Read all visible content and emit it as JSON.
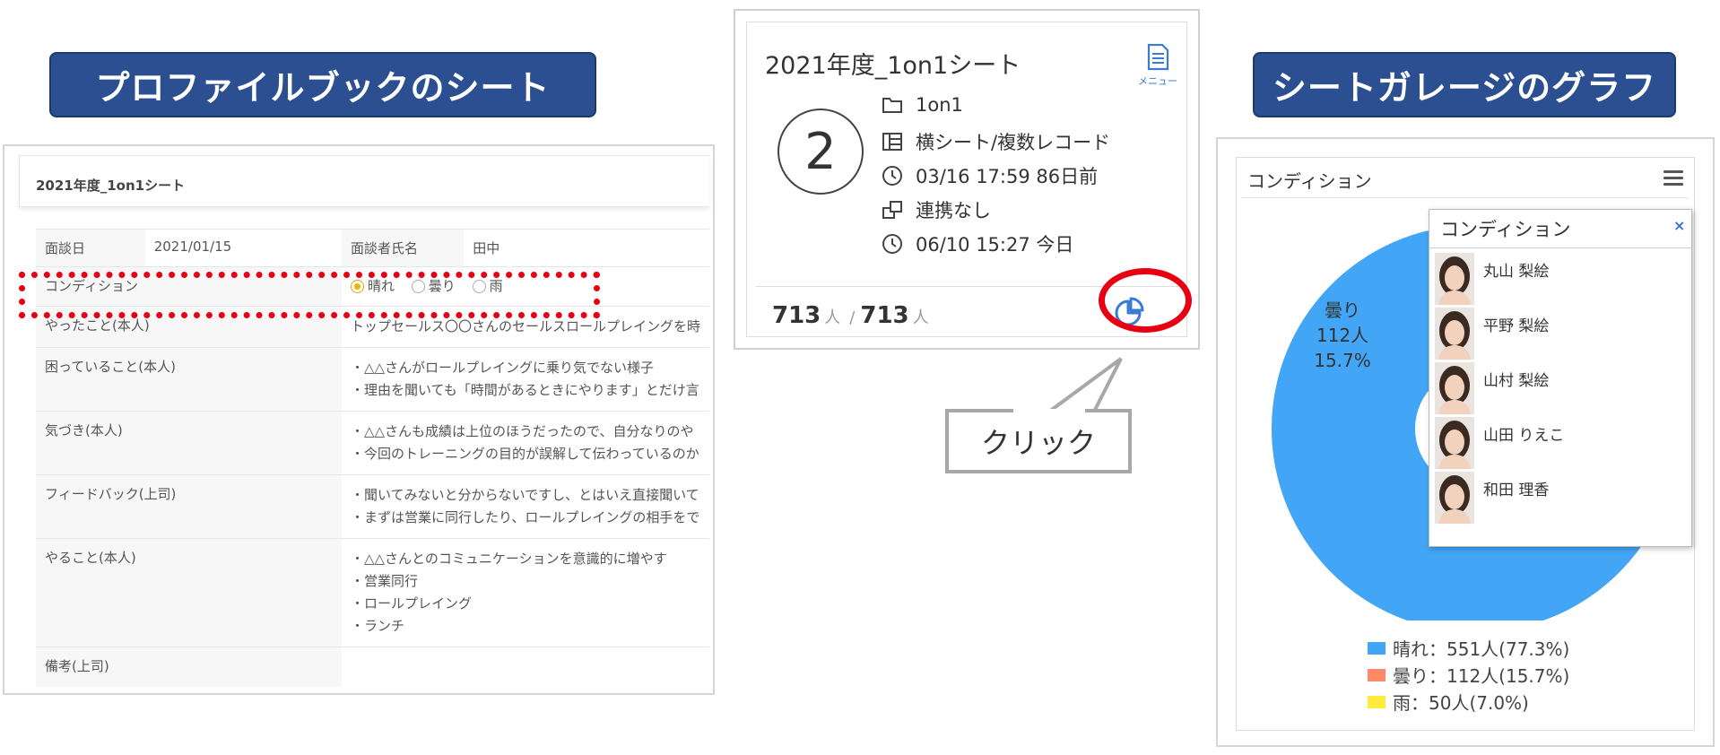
{
  "left_banner": {
    "label": "プロファイルブックのシート"
  },
  "right_banner": {
    "label": "シートガレージのグラフ"
  },
  "sheet": {
    "title": "2021年度_1on1シート",
    "rows": [
      {
        "label": "面談日",
        "value": "2021/01/15",
        "label2": "面談者氏名",
        "value2": "田中"
      },
      {
        "label": "コンディション",
        "options": [
          "晴れ",
          "曇り",
          "雨"
        ],
        "selected": "晴れ"
      },
      {
        "label": "やったこと(本人)",
        "lines": [
          "トップセールス〇〇さんのセールスロールプレイングを時"
        ]
      },
      {
        "label": "困っていること(本人)",
        "lines": [
          "・△△さんがロールプレイングに乗り気でない様子",
          "・理由を聞いても「時間があるときにやります」とだけ言"
        ]
      },
      {
        "label": "気づき(本人)",
        "lines": [
          "・△△さんも成績は上位のほうだったので、自分なりのや",
          "・今回のトレーニングの目的が誤解して伝わっているのか"
        ]
      },
      {
        "label": "フィードバック(上司)",
        "lines": [
          "・聞いてみないと分からないですし、とはいえ直接聞いて",
          "・まずは営業に同行したり、ロールプレイングの相手をで"
        ]
      },
      {
        "label": "やること(本人)",
        "lines": [
          "・△△さんとのコミュニケーションを意識的に増やす",
          "・営業同行",
          "・ロールプレイング",
          "・ランチ"
        ]
      },
      {
        "label": "備考(上司)",
        "lines": []
      }
    ]
  },
  "card": {
    "title": "2021年度_1on1シート",
    "menu_label": "メニュー",
    "count_badge": "2",
    "folder": "1on1",
    "sheet_type": "横シート/複数レコード",
    "created": "03/16 17:59 86日前",
    "link_status": "連携なし",
    "updated": "06/10 15:27 今日",
    "count_done": "713",
    "count_total": "713",
    "unit": "人",
    "separator": "/"
  },
  "callout": {
    "label": "クリック"
  },
  "graph": {
    "title": "コンディション",
    "slice_label_name": "曇り",
    "slice_label_count": "112人",
    "slice_label_pct": "15.7%",
    "legend": [
      {
        "text": "晴れ：551人(77.3%)",
        "color": "#42a5f5"
      },
      {
        "text": "曇り：112人(15.7%)",
        "color": "#ff8a65"
      },
      {
        "text": "雨：50人(7.0%)",
        "color": "#ffeb3b"
      }
    ]
  },
  "chart_data": {
    "type": "pie",
    "title": "コンディション",
    "categories": [
      "晴れ",
      "曇り",
      "雨"
    ],
    "values": [
      551,
      112,
      50
    ],
    "percentages": [
      77.3,
      15.7,
      7.0
    ],
    "colors": [
      "#42a5f5",
      "#ff8a65",
      "#ffeb3b"
    ]
  },
  "popup": {
    "title": "コンディション",
    "close": "×",
    "people": [
      "丸山 梨絵",
      "平野 梨絵",
      "山村 梨絵",
      "山田 りえこ",
      "和田 理香"
    ]
  }
}
